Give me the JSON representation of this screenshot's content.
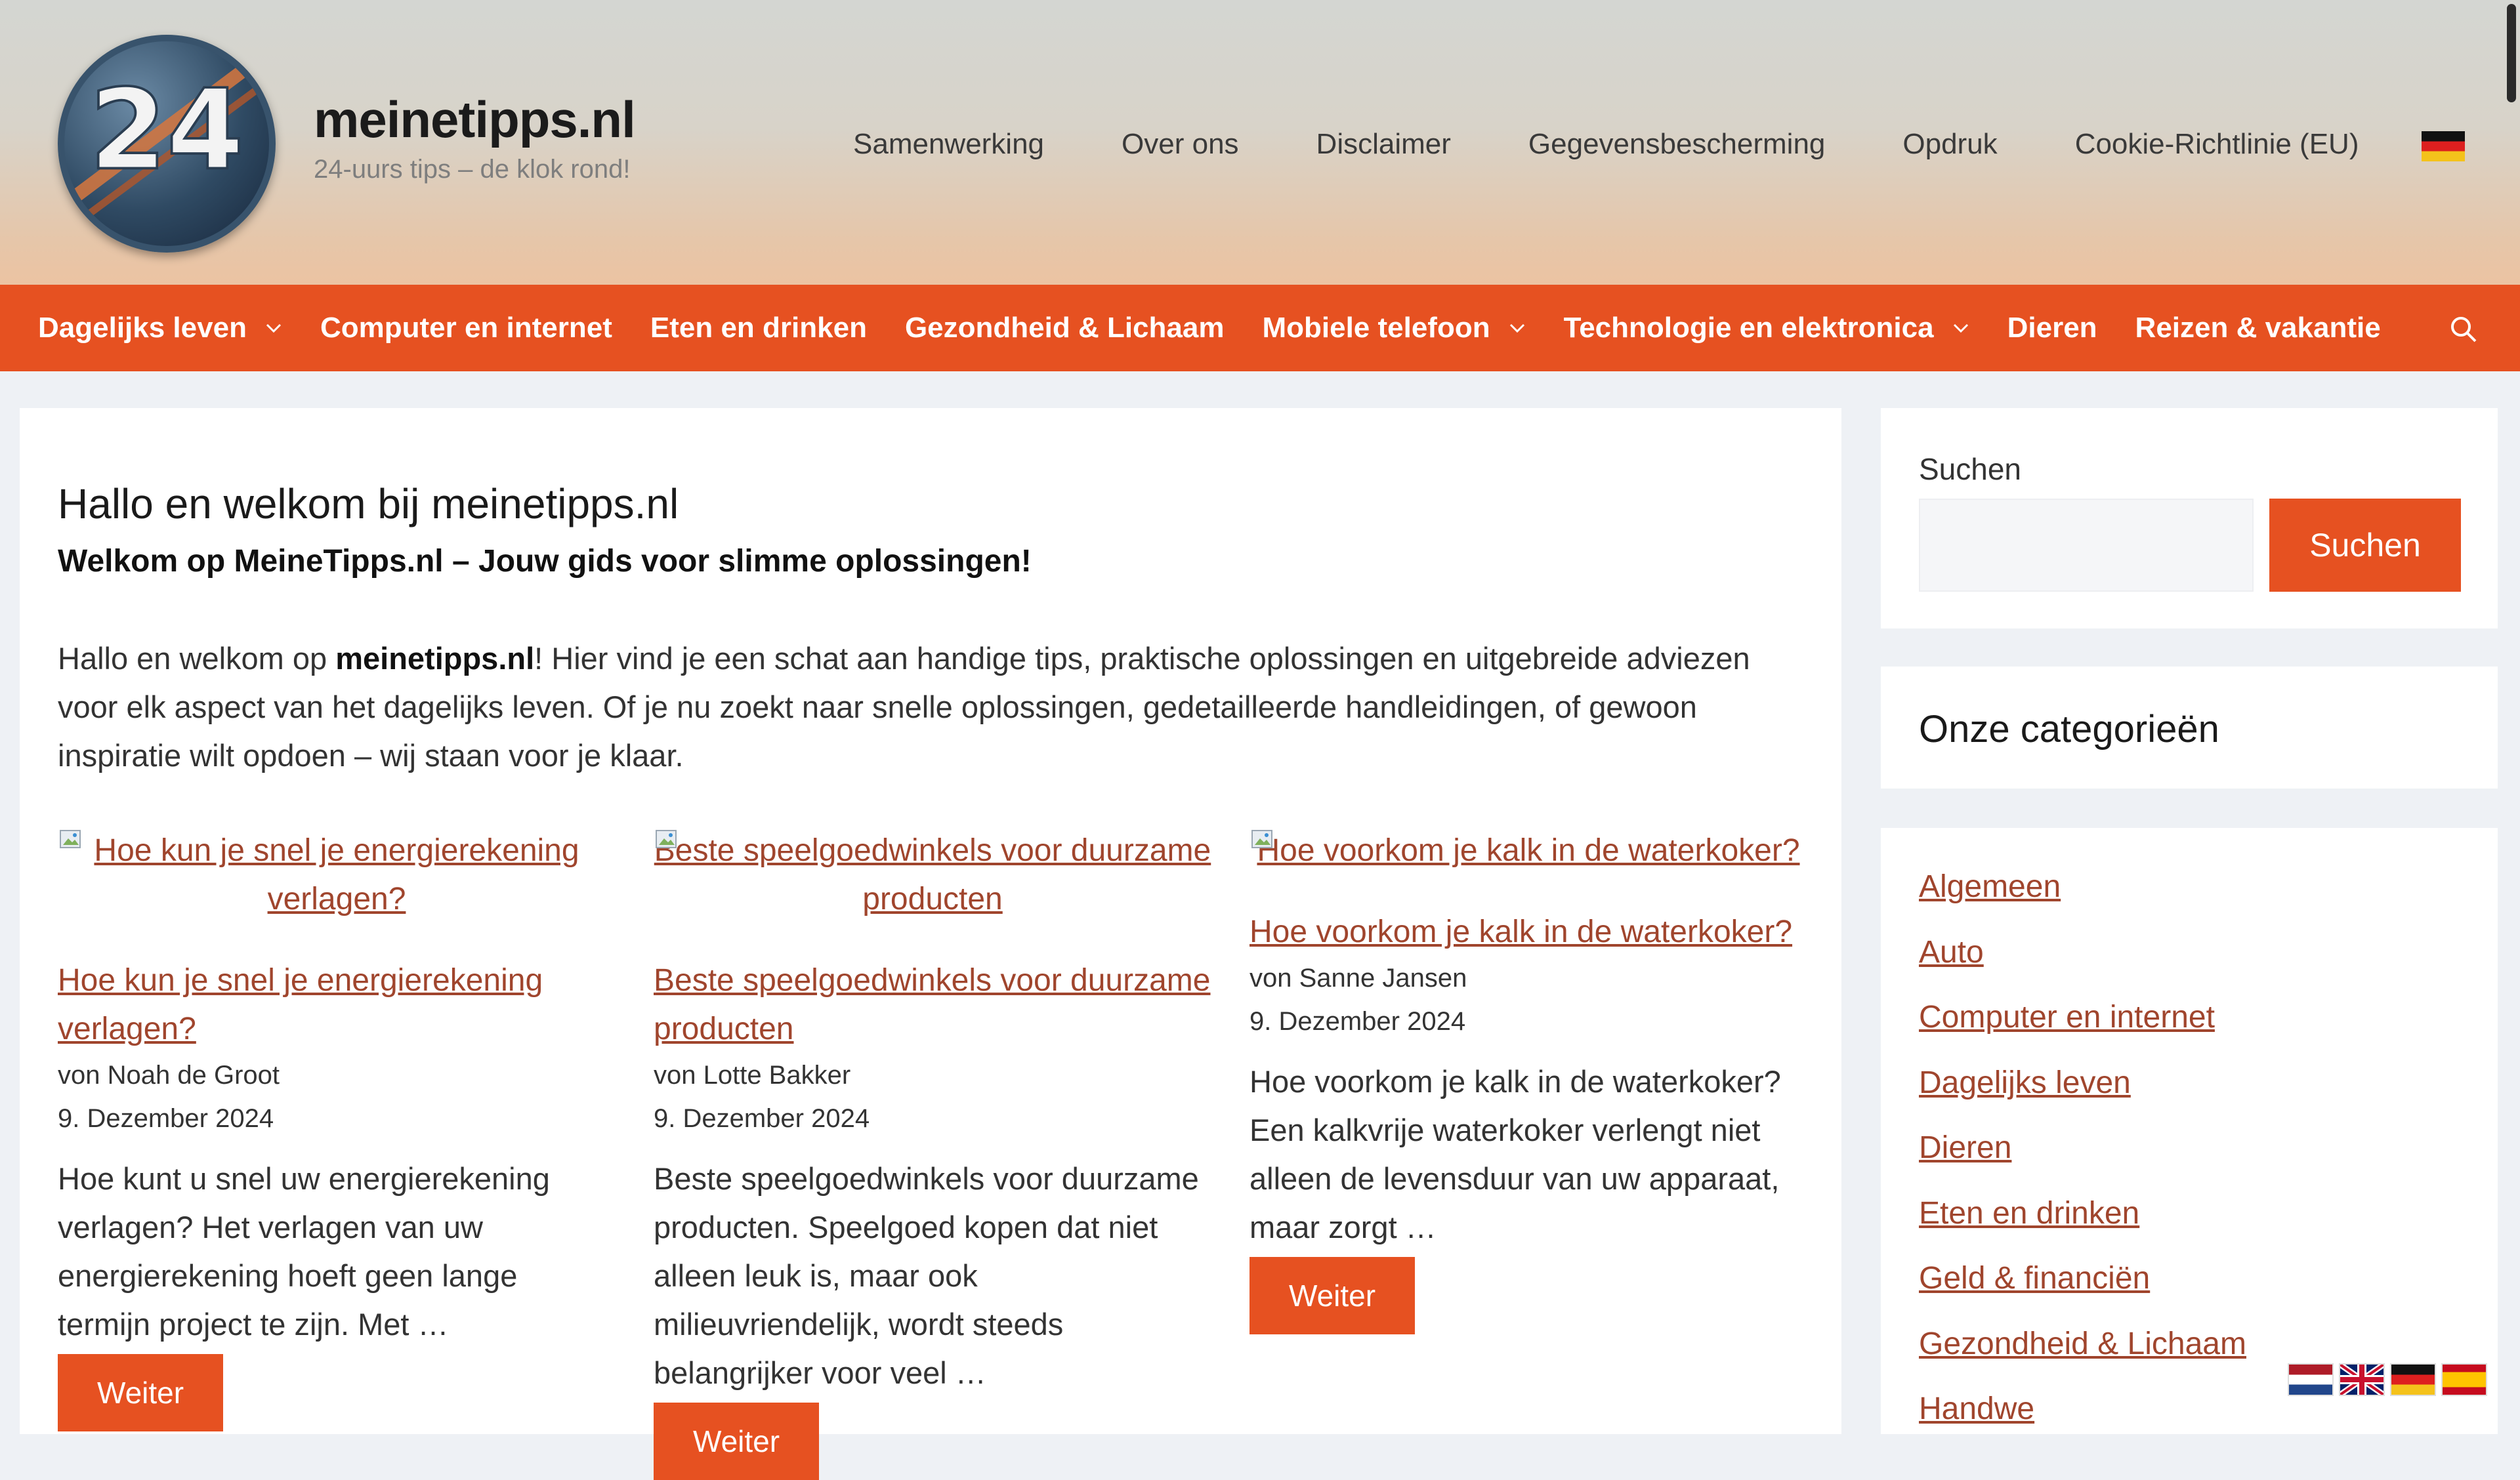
{
  "header": {
    "site_title": "meinetipps.nl",
    "tagline": "24-uurs tips – de klok rond!",
    "logo_text": "24",
    "top_nav": [
      "Samenwerking",
      "Over ons",
      "Disclaimer",
      "Gegevensbescherming",
      "Opdruk",
      "Cookie-Richtlinie (EU)"
    ],
    "language_flag": "de-flag-icon"
  },
  "main_nav": {
    "items": [
      {
        "label": "Dagelijks leven",
        "has_dropdown": true
      },
      {
        "label": "Computer en internet",
        "has_dropdown": false
      },
      {
        "label": "Eten en drinken",
        "has_dropdown": false
      },
      {
        "label": "Gezondheid & Lichaam",
        "has_dropdown": false
      },
      {
        "label": "Mobiele telefoon",
        "has_dropdown": true
      },
      {
        "label": "Technologie en elektronica",
        "has_dropdown": true
      },
      {
        "label": "Dieren",
        "has_dropdown": false
      },
      {
        "label": "Reizen & vakantie",
        "has_dropdown": false
      }
    ],
    "accent_color": "#e65121"
  },
  "content": {
    "title": "Hallo en welkom bij meinetipps.nl",
    "intro_bold": "Welkom op MeineTipps.nl – Jouw gids voor slimme oplossingen!",
    "intro_prefix": "Hallo en welkom op ",
    "intro_strong": "meinetipps.nl",
    "intro_rest": "! Hier vind je een schat aan handige tips, praktische oplossingen en uitgebreide adviezen voor elk aspect van het dagelijks leven. Of je nu zoekt naar snelle oplossingen, gedetailleerde handleidingen, of gewoon inspiratie wilt opdoen – wij staan voor je klaar.",
    "posts": [
      {
        "image_alt": "Hoe kun je snel je energierekening verlagen?",
        "title": "Hoe kun je snel je energierekening verlagen?",
        "author": "von Noah de Groot",
        "date": "9. Dezember 2024",
        "excerpt": "Hoe kunt u snel uw energierekening verlagen? Het verlagen van uw energierekening hoeft geen lange termijn project te zijn. Met …",
        "more": "Weiter"
      },
      {
        "image_alt": "Beste speelgoedwinkels voor duurzame producten",
        "title": "Beste speelgoedwinkels voor duurzame producten",
        "author": "von Lotte Bakker",
        "date": "9. Dezember 2024",
        "excerpt": "Beste speelgoedwinkels voor duurzame producten. Speelgoed kopen dat niet alleen leuk is, maar ook milieuvriendelijk, wordt steeds belangrijker voor veel …",
        "more": "Weiter"
      },
      {
        "image_alt": "Hoe voorkom je kalk in de waterkoker?",
        "title": "Hoe voorkom je kalk in de waterkoker?",
        "author": "von Sanne Jansen",
        "date": "9. Dezember 2024",
        "excerpt": "Hoe voorkom je kalk in de waterkoker? Een kalkvrije waterkoker verlengt niet alleen de levensduur van uw apparaat, maar zorgt …",
        "more": "Weiter"
      }
    ]
  },
  "sidebar": {
    "search_label": "Suchen",
    "search_button": "Suchen",
    "categories_title": "Onze categorieën",
    "categories": [
      "Algemeen",
      "Auto",
      "Computer en internet",
      "Dagelijks leven",
      "Dieren",
      "Eten en drinken",
      "Geld & financiën",
      "Gezondheid & Lichaam",
      "Handwe"
    ]
  },
  "language_flags": [
    "nl-flag-icon",
    "en-flag-icon",
    "de-flag-icon",
    "es-flag-icon"
  ]
}
